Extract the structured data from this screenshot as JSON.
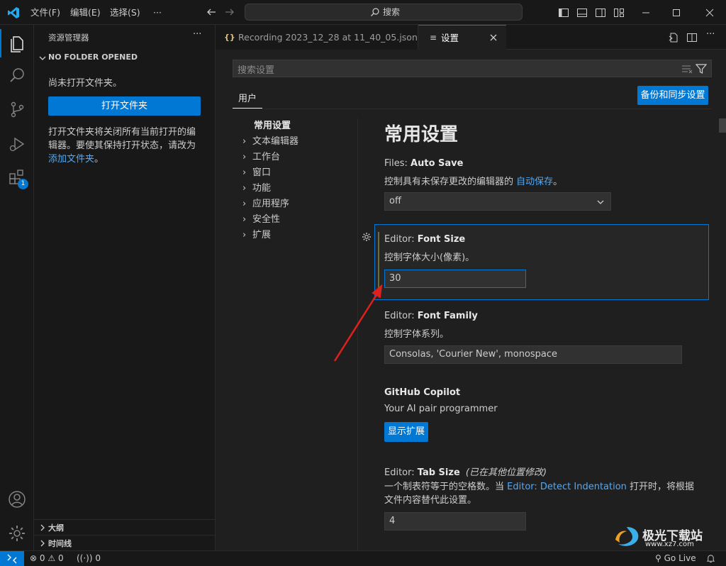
{
  "titlebar": {
    "menu": [
      "文件(F)",
      "编辑(E)",
      "选择(S)",
      "···"
    ],
    "search_label": "搜索",
    "colors": {
      "accent": "#0078d4",
      "logo": "#23a9f2"
    }
  },
  "activity_bar": {
    "extensions_badge": "1"
  },
  "sidebar": {
    "title": "资源管理器",
    "more": "···",
    "section_header": "NO FOLDER OPENED",
    "no_folder_text": "尚未打开文件夹。",
    "open_folder_button": "打开文件夹",
    "info_text": "打开文件夹将关闭所有当前打开的编辑器。要使其保持打开状态，请改为",
    "add_folder_link": "添加文件夹",
    "info_end": "。",
    "outline_label": "大纲",
    "timeline_label": "时间线"
  },
  "tabs": [
    {
      "label": "Recording 2023_12_28 at 11_40_05.json",
      "icon": "{}"
    },
    {
      "label": "设置",
      "icon": "≡",
      "active": true
    }
  ],
  "settings": {
    "search_placeholder": "搜索设置",
    "scope_tab": "用户",
    "sync_button": "备份和同步设置",
    "toc": [
      {
        "label": "常用设置",
        "bold": true,
        "chevron": false
      },
      {
        "label": "文本编辑器",
        "chevron": true
      },
      {
        "label": "工作台",
        "chevron": true
      },
      {
        "label": "窗口",
        "chevron": true
      },
      {
        "label": "功能",
        "chevron": true
      },
      {
        "label": "应用程序",
        "chevron": true
      },
      {
        "label": "安全性",
        "chevron": true
      },
      {
        "label": "扩展",
        "chevron": true
      }
    ],
    "heading": "常用设置",
    "auto_save": {
      "category": "Files: ",
      "name": "Auto Save",
      "desc_before": "控制具有未保存更改的编辑器的 ",
      "desc_link": "自动保存",
      "desc_after": "。",
      "value": "off"
    },
    "font_size": {
      "category": "Editor: ",
      "name": "Font Size",
      "desc": "控制字体大小(像素)。",
      "value": "30"
    },
    "font_family": {
      "category": "Editor: ",
      "name": "Font Family",
      "desc": "控制字体系列。",
      "value": "Consolas, 'Courier New', monospace"
    },
    "copilot": {
      "name": "GitHub Copilot",
      "desc": "Your AI pair programmer",
      "button": "显示扩展"
    },
    "tab_size": {
      "category": "Editor: ",
      "name": "Tab Size",
      "modified": "(已在其他位置修改)",
      "desc_before": "一个制表符等于的空格数。当 ",
      "desc_link": "Editor: Detect Indentation",
      "desc_after": " 打开时，将根据文件内容替代此设置。",
      "value": "4"
    }
  },
  "statusbar": {
    "errors": "0",
    "warnings": "0",
    "ports": "0",
    "go_live": "Go Live"
  },
  "watermark": {
    "text": "极光下载站",
    "url": "www.xz7.com"
  }
}
